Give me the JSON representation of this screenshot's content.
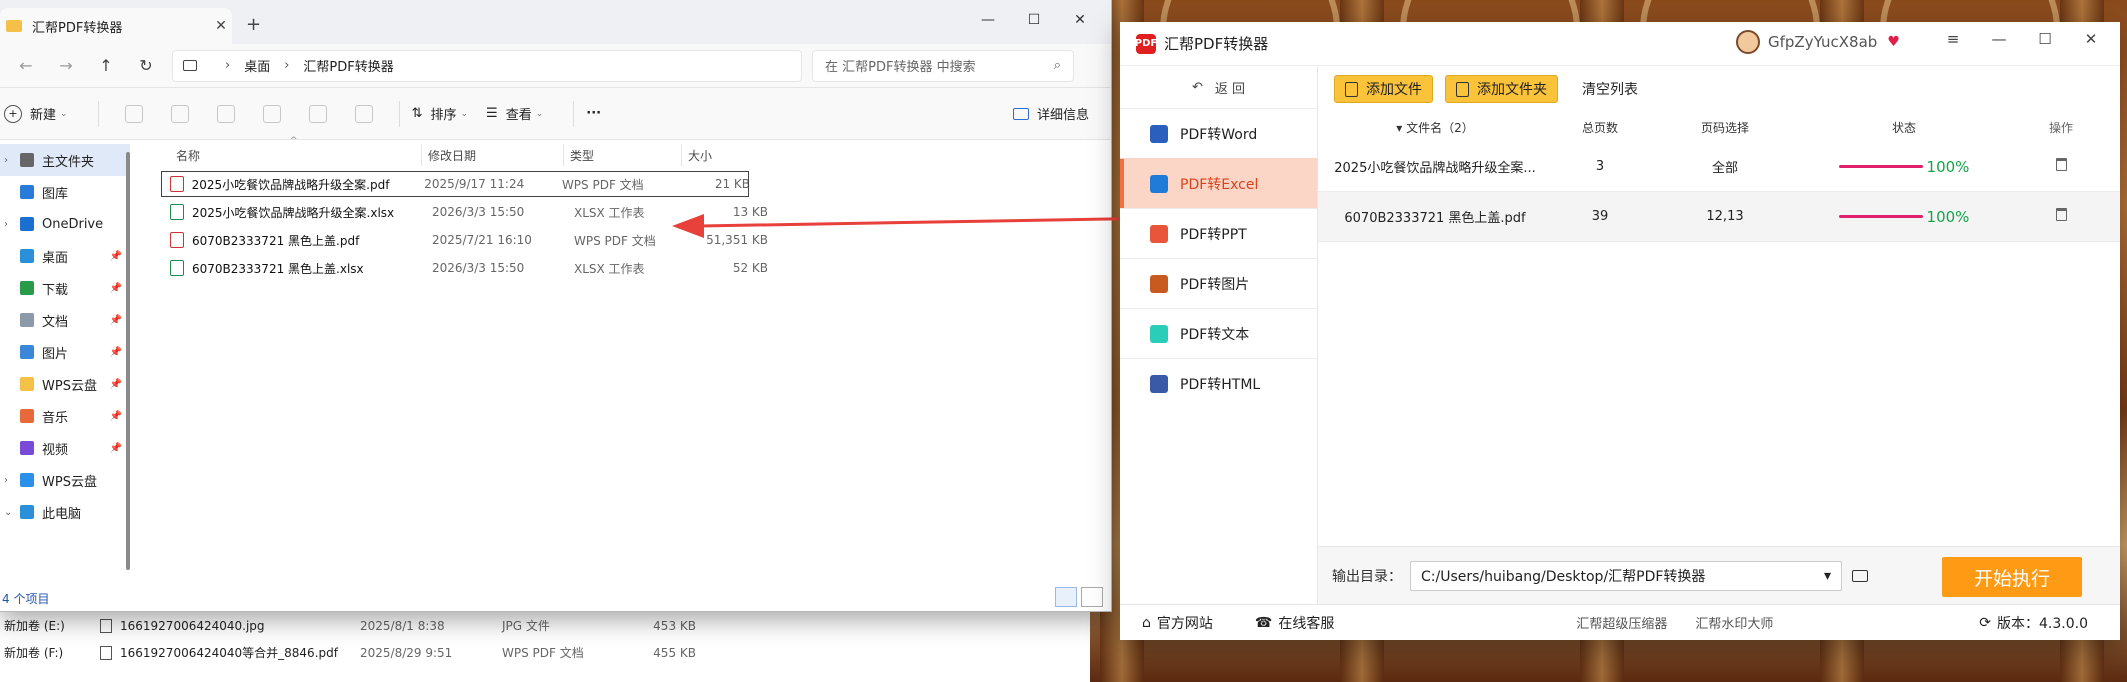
{
  "explorer": {
    "tab_title": "汇帮PDF转换器",
    "new_tab": "+",
    "controls": [
      "—",
      "☐",
      "✕"
    ],
    "nav_buttons": [
      "←",
      "→",
      "↑",
      "↻"
    ],
    "breadcrumb": [
      "桌面",
      "汇帮PDF转换器"
    ],
    "search_placeholder": "在 汇帮PDF转换器 中搜索",
    "toolbar": {
      "new_label": "新建",
      "sort_label": "排序",
      "view_label": "查看",
      "more_label": "···",
      "details_label": "详细信息"
    },
    "sidebar": [
      {
        "label": "主文件夹",
        "selected": true,
        "chevron": "›",
        "icon_color": "#666666"
      },
      {
        "label": "图库",
        "chevron": "",
        "icon_color": "#2a7ad8"
      },
      {
        "label": "OneDrive",
        "chevron": "›",
        "icon_color": "#1c6fd1"
      },
      {
        "gap": true
      },
      {
        "label": "桌面",
        "pin": true,
        "icon_color": "#2b8fd8"
      },
      {
        "label": "下载",
        "pin": true,
        "icon_color": "#2a9a4a"
      },
      {
        "label": "文档",
        "pin": true,
        "icon_color": "#8a9aaa"
      },
      {
        "label": "图片",
        "pin": true,
        "icon_color": "#3a86d8"
      },
      {
        "label": "WPS云盘",
        "pin": true,
        "icon_color": "#f5c048"
      },
      {
        "label": "音乐",
        "pin": true,
        "icon_color": "#e86a3a"
      },
      {
        "label": "视频",
        "pin": true,
        "icon_color": "#7a4ad8"
      },
      {
        "gap": true
      },
      {
        "label": "WPS云盘",
        "chevron": "›",
        "icon_color": "#2a90e8"
      },
      {
        "label": "此电脑",
        "chevron": "⌄",
        "icon_color": "#2a90d8"
      }
    ],
    "columns": [
      "名称",
      "修改日期",
      "类型",
      "大小"
    ],
    "files": [
      {
        "name": "2025小吃餐饮品牌战略升级全案.pdf",
        "date": "2025/9/17 11:24",
        "type": "WPS PDF 文档",
        "size": "21 KB",
        "kind": "pdf",
        "selected": true
      },
      {
        "name": "2025小吃餐饮品牌战略升级全案.xlsx",
        "date": "2026/3/3 15:50",
        "type": "XLSX 工作表",
        "size": "13 KB",
        "kind": "xls"
      },
      {
        "name": "6070B2333721 黑色上盖.pdf",
        "date": "2025/7/21 16:10",
        "type": "WPS PDF 文档",
        "size": "51,351 KB",
        "kind": "pdf"
      },
      {
        "name": "6070B2333721 黑色上盖.xlsx",
        "date": "2026/3/3 15:50",
        "type": "XLSX 工作表",
        "size": "52 KB",
        "kind": "xls"
      }
    ],
    "status": "4 个项目"
  },
  "explorer_back": {
    "rows": [
      {
        "left": "新加卷 (E:)",
        "name": "1661927006424040.jpg",
        "date": "2025/8/1 8:38",
        "type": "JPG 文件",
        "size": "453 KB"
      },
      {
        "left": "新加卷 (F:)",
        "name": "1661927006424040等合并_8846.pdf",
        "date": "2025/8/29 9:51",
        "type": "WPS PDF 文档",
        "size": "455 KB"
      }
    ]
  },
  "converter": {
    "app_name": "汇帮PDF转换器",
    "logo_text": "PDF",
    "user": "GfpZyYucX8ab",
    "vip_icon": "♥",
    "controls": [
      "≡",
      "—",
      "☐",
      "✕"
    ],
    "back_label": "返  回",
    "nav": [
      {
        "label": "PDF转Word",
        "icon_color": "#2b5fbd"
      },
      {
        "label": "PDF转Excel",
        "icon_color": "#1f7ad8",
        "active": true
      },
      {
        "label": "PDF转PPT",
        "icon_color": "#e8553a"
      },
      {
        "label": "PDF转图片",
        "icon_color": "#c85a20"
      },
      {
        "label": "PDF转文本",
        "icon_color": "#2acdb8"
      },
      {
        "label": "PDF转HTML",
        "icon_color": "#3a5aa8"
      }
    ],
    "add_file": "添加文件",
    "add_folder": "添加文件夹",
    "clear_list": "清空列表",
    "table_headers": [
      "▾ 文件名（2）",
      "总页数",
      "页码选择",
      "状态",
      "操作"
    ],
    "rows": [
      {
        "name": "2025小吃餐饮品牌战略升级全案...",
        "pages": "3",
        "range": "全部",
        "progress": "100%"
      },
      {
        "name": "6070B2333721 黑色上盖.pdf",
        "pages": "39",
        "range": "12,13",
        "progress": "100%"
      }
    ],
    "output_label": "输出目录：",
    "output_path": "C:/Users/huibang/Desktop/汇帮PDF转换器",
    "start_label": "开始执行",
    "footer": {
      "website": "官方网站",
      "support": "在线客服",
      "link1": "汇帮超级压缩器",
      "link2": "汇帮水印大师",
      "version": "版本：4.3.0.0"
    }
  }
}
